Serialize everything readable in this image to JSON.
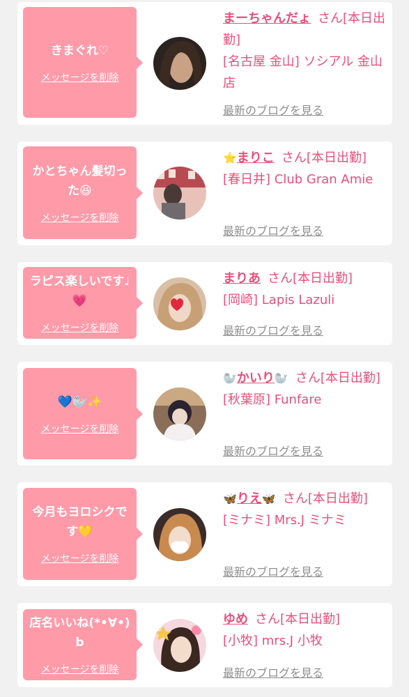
{
  "messages": [
    {
      "message_text": "きまぐれ♡",
      "delete_label": "メッセージを削除",
      "name_prefix": "",
      "girl_name": "まーちゃんだょ",
      "name_suffix": "",
      "status": "さん[本日出勤]",
      "shop": "[名古屋 金山] ソシアル 金山店",
      "blog_label": "最新のブログを見る"
    },
    {
      "message_text": "かとちゃん髪切った😆",
      "delete_label": "メッセージを削除",
      "name_prefix": "⭐️",
      "girl_name": "まりこ",
      "name_suffix": "",
      "status": "さん[本日出勤]",
      "shop": "[春日井] Club Gran Amie",
      "blog_label": "最新のブログを見る"
    },
    {
      "message_text": "ラピス楽しいです♩💗",
      "delete_label": "メッセージを削除",
      "name_prefix": "",
      "girl_name": "まりあ",
      "name_suffix": "",
      "status": "さん[本日出勤]",
      "shop": "[岡崎] Lapis Lazuli",
      "blog_label": "最新のブログを見る"
    },
    {
      "message_text": "💙🦭✨",
      "delete_label": "メッセージを削除",
      "name_prefix": "🦭",
      "girl_name": "かいり",
      "name_suffix": "🦭",
      "status": "さん[本日出勤]",
      "shop": "[秋葉原] Funfare",
      "blog_label": "最新のブログを見る"
    },
    {
      "message_text": "今月もヨロシクです💛",
      "delete_label": "メッセージを削除",
      "name_prefix": "🦋",
      "girl_name": "りえ",
      "name_suffix": "🦋",
      "status": "さん[本日出勤]",
      "shop": "[ミナミ] Mrs.J ミナミ",
      "blog_label": "最新のブログを見る"
    },
    {
      "message_text": "店名いいね(*•∀•)b",
      "delete_label": "メッセージを削除",
      "name_prefix": "",
      "girl_name": "ゆめ",
      "name_suffix": "",
      "status": "さん[本日出勤]",
      "shop": "[小牧] mrs.J 小牧",
      "blog_label": "最新のブログを見る"
    }
  ],
  "colors": {
    "page_background": "#f1f1f1",
    "bubble": "#ff9aa9",
    "accent_pink": "#e8507a",
    "link_gray": "#8f8f8f"
  }
}
